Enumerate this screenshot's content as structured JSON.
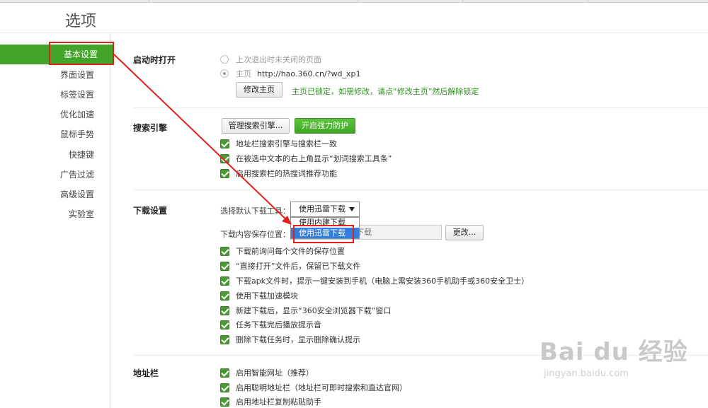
{
  "page_title": "选项",
  "sidebar": {
    "active": "基本设置",
    "items": [
      "界面设置",
      "标签设置",
      "优化加速",
      "鼠标手势",
      "快捷键",
      "广告过滤",
      "高级设置",
      "实验室"
    ]
  },
  "startup": {
    "label": "启动时打开",
    "option_last": "上次退出时未关闭的页面",
    "option_home": "主页",
    "home_url": "http://hao.360.cn/?wd_xp1",
    "modify_btn": "修改主页",
    "locked_msg": "主页已锁定，如需修改，请点“修改主页”然后解除锁定"
  },
  "search": {
    "label": "搜索引擎",
    "manage_btn": "管理搜索引擎...",
    "protect_btn": "开启强力防护",
    "checks": [
      "地址栏搜索引擎与搜索栏一致",
      "在被选中文本的右上角显示“划词搜索工具条”",
      "启用搜索栏的热搜词推荐功能"
    ]
  },
  "download": {
    "label": "下载设置",
    "tool_label": "选择默认下载工具：",
    "selected": "使用迅雷下载",
    "options": [
      "使用内建下载",
      "使用迅雷下载"
    ],
    "path_label": "下载内容保存位置：",
    "path_value": "下载",
    "change_btn": "更改...",
    "checks": [
      "下载前询问每个文件的保存位置",
      "“直接打开”文件后，保留已下载文件",
      "下载apk文件时，提示一键安装到手机（电脑上需安装360手机助手或360安全卫士）",
      "使用下载加速模块",
      "新建下载后，显示“360安全浏览器下载”窗口",
      "任务下载完后播放提示音",
      "删除下载任务时，显示删除确认提示"
    ]
  },
  "address_bar": {
    "label": "地址栏",
    "checks": [
      "启用智能网址（推荐）",
      "启用聪明地址栏（地址栏可即时搜索和直达官网）",
      "启用地址栏复制粘贴助手"
    ]
  },
  "watermark": {
    "brand": "Bai du 经验",
    "url": "jingyan.baidu.com"
  },
  "colors": {
    "accent_green": "#42a52a",
    "annotation_red": "#e0201b",
    "selection_blue": "#2f7ee0"
  }
}
